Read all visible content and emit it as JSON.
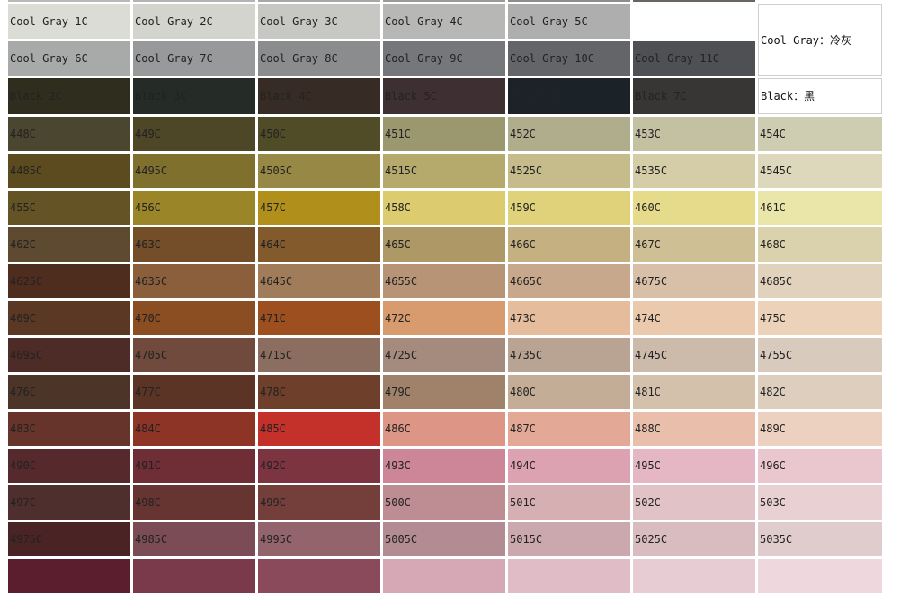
{
  "swatch_rows": [
    [
      [
        "Cool Gray 1C",
        "#dcdcd7"
      ],
      [
        "Cool Gray 2C",
        "#d4d4cf"
      ],
      [
        "Cool Gray 3C",
        "#c7c7c4"
      ],
      [
        "Cool Gray 4C",
        "#b7b7b6"
      ],
      [
        "Cool Gray 5C",
        "#aeaeae"
      ],
      [
        "",
        ""
      ],
      [
        "Cool Gray：冷灰",
        "legend"
      ]
    ],
    [
      [
        "Cool Gray 6C",
        "#a8aaa9"
      ],
      [
        "Cool Gray 7C",
        "#98999a"
      ],
      [
        "Cool Gray 8C",
        "#8b8c8e"
      ],
      [
        "Cool Gray 9C",
        "#76777b"
      ],
      [
        "Cool Gray 10C",
        "#636569"
      ],
      [
        "Cool Gray 11C",
        "#4e5054"
      ]
    ],
    [
      [
        "Black 2C",
        "#2f2d1e"
      ],
      [
        "Black 3C",
        "#252b27"
      ],
      [
        "Black 4C",
        "#372c25"
      ],
      [
        "Black 5C",
        "#3d2f32"
      ],
      [
        "Black 6C",
        "#1b2228"
      ],
      [
        "Black 7C",
        "#383634"
      ],
      [
        "Black：黑",
        "legend"
      ]
    ],
    [
      [
        "448C",
        "#4b4630"
      ],
      [
        "449C",
        "#4d4627"
      ],
      [
        "450C",
        "#504c28"
      ],
      [
        "451C",
        "#9b9870"
      ],
      [
        "452C",
        "#b0ad8c"
      ],
      [
        "453C",
        "#c3c1a2"
      ],
      [
        "454C",
        "#cfcdb1"
      ]
    ],
    [
      [
        "4485C",
        "#5c4b1f"
      ],
      [
        "4495C",
        "#80702e"
      ],
      [
        "4505C",
        "#978945"
      ],
      [
        "4515C",
        "#b5a96c"
      ],
      [
        "4525C",
        "#c6bc8b"
      ],
      [
        "4535C",
        "#d4cda8"
      ],
      [
        "4545C",
        "#ddd8bb"
      ]
    ],
    [
      [
        "455C",
        "#645425"
      ],
      [
        "456C",
        "#9b8529"
      ],
      [
        "457C",
        "#b0901b"
      ],
      [
        "458C",
        "#dccc6f"
      ],
      [
        "459C",
        "#dfd27b"
      ],
      [
        "460C",
        "#e5db8b"
      ],
      [
        "461C",
        "#eae5a9"
      ]
    ],
    [
      [
        "462C",
        "#5e4a30"
      ],
      [
        "463C",
        "#734e29"
      ],
      [
        "464C",
        "#835a2c"
      ],
      [
        "465C",
        "#ae9865"
      ],
      [
        "466C",
        "#c4b081"
      ],
      [
        "467C",
        "#cfbf94"
      ],
      [
        "468C",
        "#dad1ad"
      ]
    ],
    [
      [
        "4625C",
        "#4e2d1f"
      ],
      [
        "4635C",
        "#8b5e3c"
      ],
      [
        "4645C",
        "#a17c5b"
      ],
      [
        "4655C",
        "#b89476"
      ],
      [
        "4665C",
        "#c7a88c"
      ],
      [
        "4675C",
        "#d8c0a8"
      ],
      [
        "4685C",
        "#e1d2bd"
      ]
    ],
    [
      [
        "469C",
        "#5a3823"
      ],
      [
        "470C",
        "#8b4d22"
      ],
      [
        "471C",
        "#9e4f1f"
      ],
      [
        "472C",
        "#d79b6d"
      ],
      [
        "473C",
        "#e6bd9c"
      ],
      [
        "474C",
        "#eac9ac"
      ],
      [
        "475C",
        "#ecd2b9"
      ]
    ],
    [
      [
        "4695C",
        "#4d2b26"
      ],
      [
        "4705C",
        "#6f4a3d"
      ],
      [
        "4715C",
        "#8c6e61"
      ],
      [
        "4725C",
        "#a58b7d"
      ],
      [
        "4735C",
        "#b9a393"
      ],
      [
        "4745C",
        "#ccbaaa"
      ],
      [
        "4755C",
        "#d9cabe"
      ]
    ],
    [
      [
        "476C",
        "#4c3528"
      ],
      [
        "477C",
        "#5b3426"
      ],
      [
        "478C",
        "#6e3f2b"
      ],
      [
        "479C",
        "#a0826a"
      ],
      [
        "480C",
        "#c3ad96"
      ],
      [
        "481C",
        "#d4c1ac"
      ],
      [
        "482C",
        "#ddcebd"
      ]
    ],
    [
      [
        "483C",
        "#66342a"
      ],
      [
        "484C",
        "#8e3427"
      ],
      [
        "485C",
        "#c4302a"
      ],
      [
        "486C",
        "#dd9585"
      ],
      [
        "487C",
        "#e4a996"
      ],
      [
        "488C",
        "#e9bfac"
      ],
      [
        "489C",
        "#ecd0c0"
      ]
    ],
    [
      [
        "490C",
        "#56292d"
      ],
      [
        "491C",
        "#6f2d35"
      ],
      [
        "492C",
        "#7b3440"
      ],
      [
        "493C",
        "#cc8697"
      ],
      [
        "494C",
        "#dca2b2"
      ],
      [
        "495C",
        "#e5b6c3"
      ],
      [
        "496C",
        "#eac6cf"
      ]
    ],
    [
      [
        "497C",
        "#4f2f2e"
      ],
      [
        "498C",
        "#663532"
      ],
      [
        "499C",
        "#743f3a"
      ],
      [
        "500C",
        "#bd8d93"
      ],
      [
        "501C",
        "#d6afb3"
      ],
      [
        "502C",
        "#e1c3c7"
      ],
      [
        "503C",
        "#e8d0d3"
      ]
    ],
    [
      [
        "4975C",
        "#4a2425"
      ],
      [
        "4985C",
        "#7b4c55"
      ],
      [
        "4995C",
        "#94646d"
      ],
      [
        "5005C",
        "#b38b92"
      ],
      [
        "5015C",
        "#cba8ad"
      ],
      [
        "5025C",
        "#d8bcbf"
      ],
      [
        "5035C",
        "#e0cccd"
      ]
    ],
    [
      [
        "",
        "#5a1e2e"
      ],
      [
        "",
        "#7b3a4c"
      ],
      [
        "",
        "#8b4a5c"
      ],
      [
        "",
        "#d6a8b5"
      ],
      [
        "",
        "#e0bcc6"
      ],
      [
        "",
        "#e8ccd4"
      ],
      [
        "",
        "#eed8de"
      ]
    ]
  ]
}
